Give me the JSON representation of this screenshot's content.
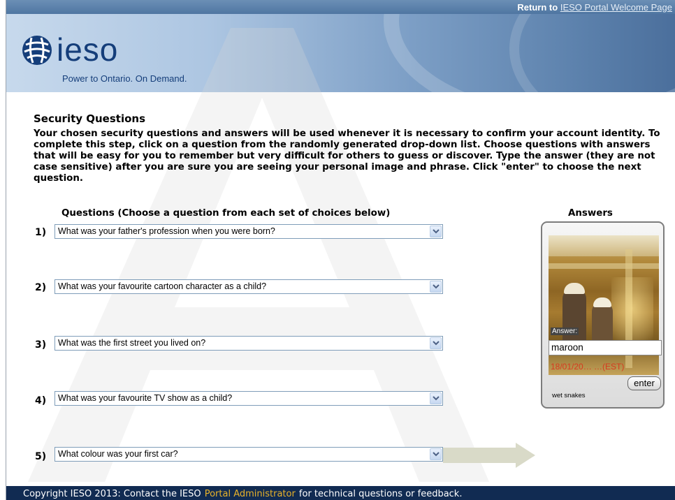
{
  "header": {
    "return_prefix": "Return to",
    "return_link": "IESO Portal Welcome Page"
  },
  "brand": {
    "name": "ieso",
    "tagline": "Power to Ontario. On Demand.",
    "colors": {
      "primary": "#153e7a",
      "accent": "#e8b22a"
    }
  },
  "page": {
    "title": "Security Questions",
    "intro": "Your chosen security questions and answers will be used whenever it is necessary to confirm your account identity. To complete this step, click on a question from the randomly generated drop-down list. Choose questions with answers that will be easy for you to remember but very difficult for others to guess or discover. Type the answer (they are not case sensitive) after you are sure you are seeing your personal image and phrase. Click \"enter\" to choose the next question."
  },
  "questions_header": "Questions (Choose a question from each set of choices below)",
  "answers_header": "Answers",
  "questions": [
    {
      "num": "1)",
      "text": "What was your father's profession when you were born?"
    },
    {
      "num": "2)",
      "text": "What was your favourite cartoon character as a child?"
    },
    {
      "num": "3)",
      "text": "What was the first street you lived on?"
    },
    {
      "num": "4)",
      "text": "What was your favourite TV show as a child?"
    },
    {
      "num": "5)",
      "text": "What colour was your first car?"
    }
  ],
  "answer_panel": {
    "label": "Answer:",
    "value": "maroon",
    "timestamp": "18/01/20… …(EST)",
    "enter_label": "enter",
    "phrase": "wet snakes"
  },
  "footer": {
    "prefix": "Copyright IESO 2013: Contact the IESO",
    "link": "Portal Administrator",
    "suffix": "for technical questions or feedback."
  },
  "icons": [
    "ieso-logo-icon",
    "chevron-down-icon",
    "arrow-right-icon"
  ]
}
